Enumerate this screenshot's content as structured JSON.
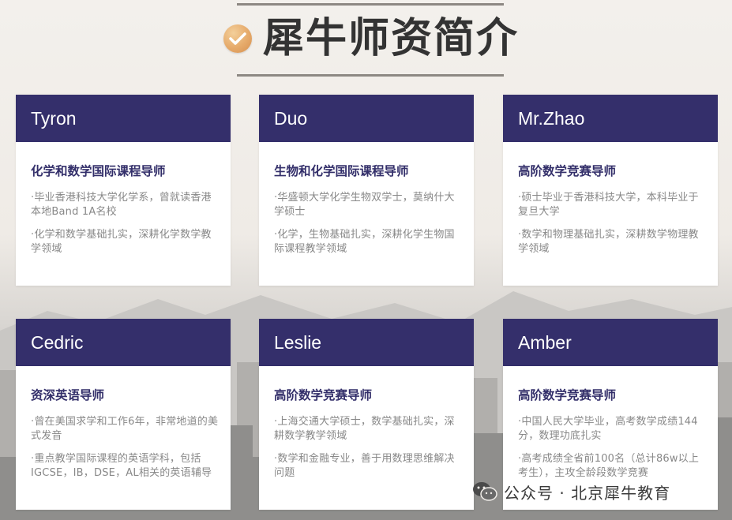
{
  "title": "犀牛师资简介",
  "cards": [
    {
      "name": "Tyron",
      "role": "化学和数学国际课程导师",
      "points": [
        "·毕业香港科技大学化学系，曾就读香港本地Band 1A名校",
        "·化学和数学基础扎实，深耕化学数学教学领域"
      ]
    },
    {
      "name": "Duo",
      "role": "生物和化学国际课程导师",
      "points": [
        "·华盛顿大学化学生物双学士，莫纳什大学硕士",
        "·化学，生物基础扎实，深耕化学生物国际课程教学领域"
      ]
    },
    {
      "name": "Mr.Zhao",
      "role": "高阶数学竞赛导师",
      "points": [
        "·硕士毕业于香港科技大学，本科毕业于复旦大学",
        "·数学和物理基础扎实，深耕数学物理教学领域"
      ]
    },
    {
      "name": "Cedric",
      "role": "资深英语导师",
      "points": [
        "·曾在美国求学和工作6年，非常地道的美式发音",
        "·重点教学国际课程的英语学科，包括IGCSE，IB，DSE，AL相关的英语辅导"
      ]
    },
    {
      "name": "Leslie",
      "role": "高阶数学竞赛导师",
      "points": [
        "·上海交通大学硕士，数学基础扎实，深耕数学教学领域",
        "·数学和金融专业，善于用数理思维解决问题"
      ]
    },
    {
      "name": "Amber",
      "role": "高阶数学竞赛导师",
      "points": [
        "·中国人民大学毕业，高考数学成绩144分，数理功底扎实",
        "·高考成绩全省前100名（总计86w以上考生），主攻全龄段数学竞赛"
      ]
    }
  ],
  "watermark": "公众号 · 北京犀牛教育",
  "colors": {
    "header": "#342f6b",
    "role": "#332f6a",
    "accent": "#e6aa6a"
  }
}
